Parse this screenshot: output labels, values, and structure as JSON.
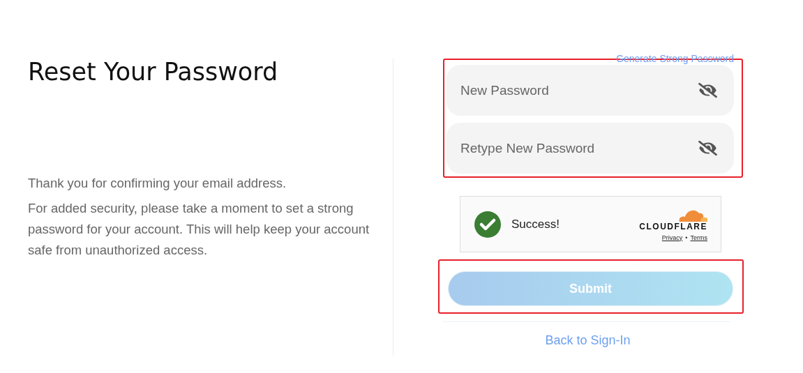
{
  "title": "Reset Your Password",
  "paragraphs": [
    "Thank you for confirming your email address.",
    "For added security, please take a moment to set a strong password for your account. This will help keep your account safe from unauthorized access."
  ],
  "generate_link": "Generate Strong Password",
  "password_fields": {
    "highlighted": true,
    "fields": [
      {
        "placeholder": "New Password",
        "masked": true
      },
      {
        "placeholder": "Retype New Password",
        "masked": true
      }
    ]
  },
  "captcha": {
    "status": "Success!",
    "verified": true,
    "brand": "CLOUDFLARE",
    "links": [
      "Privacy",
      "Terms"
    ],
    "separator": "•"
  },
  "submit": {
    "label": "Submit",
    "highlighted": true,
    "disabled": true
  },
  "back_link": "Back to Sign-In"
}
